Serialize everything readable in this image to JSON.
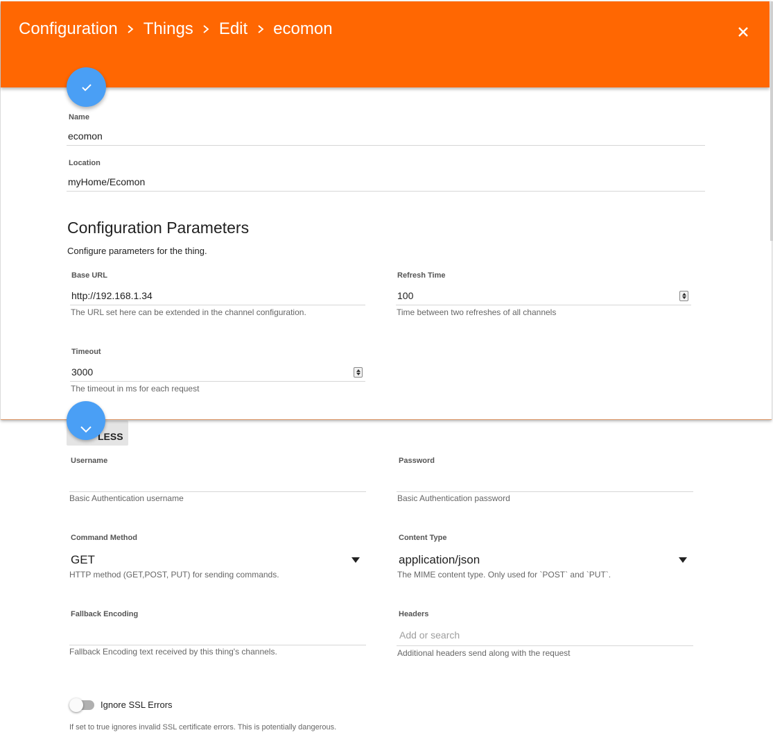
{
  "header": {
    "breadcrumb": [
      "Configuration",
      "Things",
      "Edit",
      "ecomon"
    ],
    "background_color": "#ff6702",
    "close_icon": "close-icon"
  },
  "fab": {
    "icon": "check-icon",
    "color": "#4a9ff5"
  },
  "thing": {
    "name_label": "Name",
    "name_value": "ecomon",
    "location_label": "Location",
    "location_value": "myHome/Ecomon"
  },
  "config": {
    "title": "Configuration Parameters",
    "subtitle": "Configure parameters for the thing.",
    "base_url": {
      "label": "Base URL",
      "value": "http://192.168.1.34",
      "hint": "The URL set here can be extended in the channel configuration."
    },
    "refresh_time": {
      "label": "Refresh Time",
      "value": "100",
      "hint": "Time between two refreshes of all channels"
    },
    "timeout": {
      "label": "Timeout",
      "value": "3000",
      "hint": "The timeout in ms for each request"
    }
  },
  "advanced": {
    "show_less_label": "LESS",
    "username": {
      "label": "Username",
      "value": "",
      "hint": "Basic Authentication username"
    },
    "password": {
      "label": "Password",
      "value": "",
      "hint": "Basic Authentication password"
    },
    "command_method": {
      "label": "Command Method",
      "selected": "GET",
      "hint": "HTTP method (GET,POST, PUT) for sending commands."
    },
    "content_type": {
      "label": "Content Type",
      "selected": "application/json",
      "hint": "The MIME content type. Only used for `POST` and `PUT`."
    },
    "fallback_encoding": {
      "label": "Fallback Encoding",
      "value": "",
      "hint": "Fallback Encoding text received by this thing's channels."
    },
    "headers": {
      "label": "Headers",
      "placeholder": "Add or search",
      "hint": "Additional headers send along with the request"
    },
    "ignore_ssl": {
      "label": "Ignore SSL Errors",
      "checked": false,
      "hint": "If set to true ignores invalid SSL certificate errors. This is potentially dangerous."
    }
  }
}
